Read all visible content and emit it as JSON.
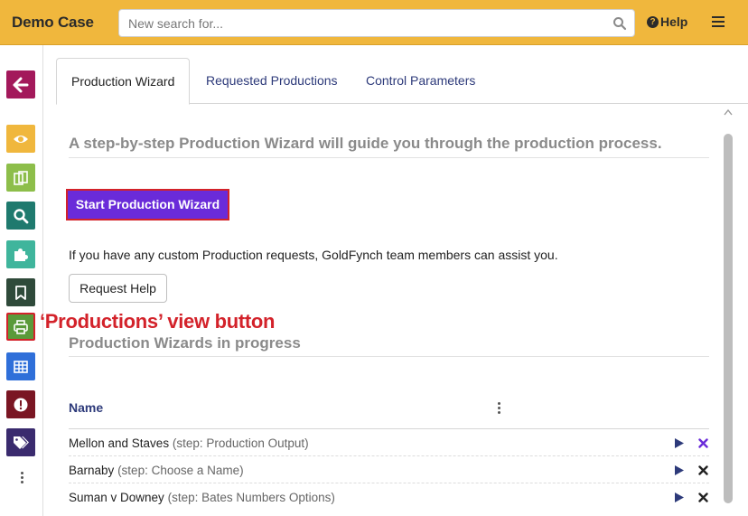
{
  "header": {
    "app_title": "Demo Case",
    "search_placeholder": "New search for...",
    "help_label": "Help"
  },
  "sidebar": {
    "buttons": [
      {
        "name": "back",
        "color": "#a3195b",
        "icon": "arrow-left-icon"
      },
      {
        "name": "view",
        "color": "#f0b73d",
        "icon": "eye-icon"
      },
      {
        "name": "documents",
        "color": "#8dbe4a",
        "icon": "copy-icon"
      },
      {
        "name": "search",
        "color": "#1f7a6e",
        "icon": "search-icon"
      },
      {
        "name": "plugins",
        "color": "#3fb59c",
        "icon": "puzzle-icon"
      },
      {
        "name": "bookmarks",
        "color": "#2f4a3a",
        "icon": "bookmark-icon"
      },
      {
        "name": "productions",
        "color": "#5a9a3a",
        "icon": "printer-icon"
      },
      {
        "name": "table",
        "color": "#2f6fd9",
        "icon": "table-icon"
      },
      {
        "name": "alerts",
        "color": "#7a1623",
        "icon": "exclamation-icon"
      },
      {
        "name": "tags",
        "color": "#3a2b6e",
        "icon": "tags-icon"
      }
    ]
  },
  "annotation": {
    "text": "‘Productions’ view button",
    "color": "#d3222a"
  },
  "tabs": [
    {
      "label": "Production Wizard",
      "active": true
    },
    {
      "label": "Requested Productions",
      "active": false
    },
    {
      "label": "Control Parameters",
      "active": false
    }
  ],
  "main": {
    "heading": "A step-by-step Production Wizard will guide you through the production process.",
    "start_button": "Start Production Wizard",
    "custom_text": "If you have any custom Production requests, GoldFynch team members can assist you.",
    "request_help_button": "Request Help",
    "in_progress_heading": "Production Wizards in progress",
    "table": {
      "header_name": "Name",
      "rows": [
        {
          "name": "Mellon and Staves",
          "step": "(step: Production Output)",
          "x_color": "#6a2bd9"
        },
        {
          "name": "Barnaby",
          "step": "(step: Choose a Name)",
          "x_color": "#222222"
        },
        {
          "name": "Suman v Downey",
          "step": "(step: Bates Numbers Options)",
          "x_color": "#222222"
        }
      ]
    }
  },
  "colors": {
    "topbar": "#f0b73d",
    "accent": "#6a2bd9",
    "link": "#2d3a7a"
  }
}
